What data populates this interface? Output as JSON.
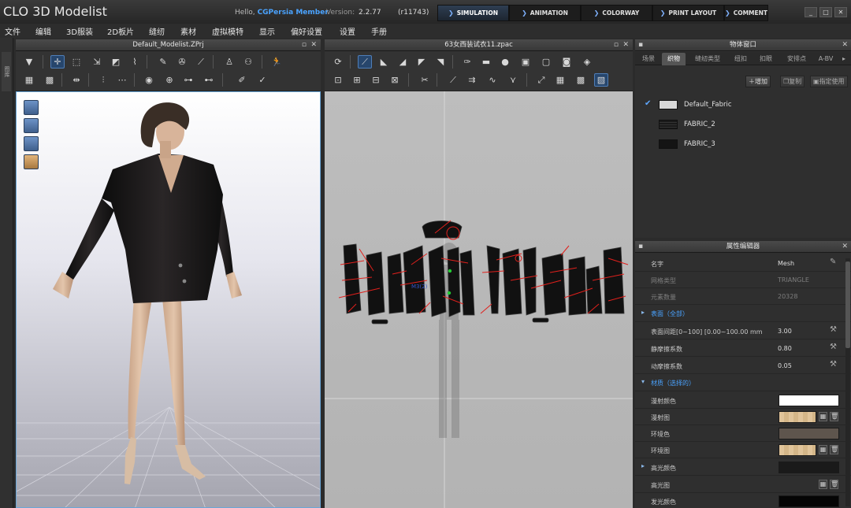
{
  "app": {
    "logo": "CLO 3D Modelist",
    "hello_prefix": "Hello,",
    "user": "CGPersia Member",
    "version_label": "Version:",
    "version": "2.2.77",
    "build": "(r11743)"
  },
  "mode_tabs": [
    "SIMULATION",
    "ANIMATION",
    "COLORWAY",
    "PRINT LAYOUT",
    "COMMENT"
  ],
  "window_controls": [
    "_",
    "□",
    "✕"
  ],
  "menu": [
    "文件",
    "编辑",
    "3D服装",
    "2D板片",
    "缝纫",
    "素材",
    "虚拟模特",
    "显示",
    "偏好设置",
    "设置",
    "手册"
  ],
  "left_strip_label": "图库",
  "panel_3d": {
    "title": "Default_Modelist.ZPrj"
  },
  "panel_2d": {
    "title": "63女西装试衣11.zpac"
  },
  "object_window": {
    "title": "物体窗口",
    "tabs": [
      "场景",
      "织物",
      "缝纫类型",
      "纽扣",
      "扣眼",
      "安排点",
      "A-BV"
    ],
    "buttons": {
      "add": "增加",
      "copy": "复制",
      "assign": "指定使用"
    },
    "fabrics": [
      {
        "name": "Default_Fabric",
        "color": "#d8d8d8",
        "checked": true
      },
      {
        "name": "FABRIC_2",
        "color": "#1a1a1a",
        "checked": false
      },
      {
        "name": "FABRIC_3",
        "color": "#141414",
        "checked": false
      }
    ]
  },
  "property_editor": {
    "title": "属性编辑器",
    "rows": [
      {
        "label": "名字",
        "value": "Mesh"
      },
      {
        "label": "网格类型",
        "value": "TRIANGLE"
      },
      {
        "label": "元素数量",
        "value": "20328"
      },
      {
        "label": "表面（全部）",
        "value": ""
      },
      {
        "label": "表面间距[0~100] [0.00~100.00 mm",
        "value": "3.00"
      },
      {
        "label": "静摩擦系数",
        "value": "0.80"
      },
      {
        "label": "动摩擦系数",
        "value": "0.05"
      },
      {
        "label": "材质（选择的）",
        "value": ""
      },
      {
        "label": "漫射颜色",
        "value": ""
      },
      {
        "label": "漫射图",
        "value": ""
      },
      {
        "label": "环境色",
        "value": ""
      },
      {
        "label": "环境图",
        "value": ""
      },
      {
        "label": "高光颜色",
        "value": ""
      },
      {
        "label": "高光图",
        "value": ""
      },
      {
        "label": "发光颜色",
        "value": ""
      }
    ],
    "colors": {
      "diffuse": "#ffffff",
      "ambient": "#5e554d",
      "specular": "#1a1a1a",
      "emission": "#050505"
    }
  },
  "overlay_2d_label": "M3(2)",
  "colors": {
    "accent_blue": "#4aa3ff",
    "window_bg": "#2b2b2b",
    "pattern_red": "#e0201c"
  }
}
